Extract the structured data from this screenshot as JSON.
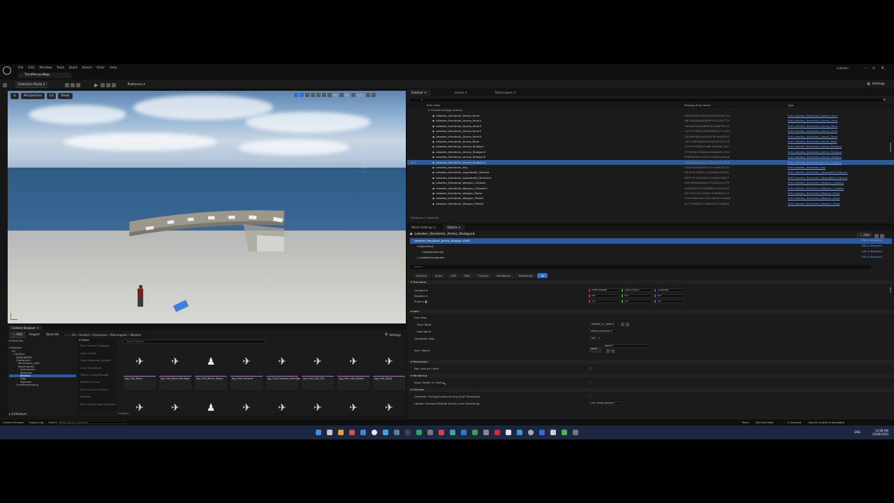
{
  "window": {
    "tab_title": "ThirdPersonMap",
    "user": "Lebedev",
    "settings_label": "Settings"
  },
  "menu": [
    "File",
    "Edit",
    "Window",
    "Tools",
    "Build",
    "Select",
    "Actor",
    "Help"
  ],
  "toolbar": {
    "selection_mode": "Selection Mode",
    "platforms": "Platforms"
  },
  "viewport": {
    "perspective": "Perspective",
    "lit": "Lit",
    "show": "Show",
    "camera_speed": "0.25",
    "fov": "90",
    "grid": "10"
  },
  "content_browser": {
    "tab": "Content Browser",
    "add": "Add",
    "import": "Import",
    "save_all": "Save All",
    "breadcrumb": [
      "All",
      "Content",
      "Characters",
      "Mannequins",
      "Meshes"
    ],
    "settings": "Settings",
    "favorites": "Favorites",
    "project": "lebedev",
    "filters": "Filters",
    "search_placeholder": "Search Meshes",
    "collections": "Collections",
    "item_count": "15 items",
    "tree": [
      "All",
      "Content",
      "GENERATED",
      "Characters",
      "Mannequin_UE4",
      "Mannequins",
      "Animations",
      "Materials",
      "Meshes",
      "Rigs",
      "Textures",
      "LevelPrototyping"
    ],
    "filter_items": [
      "Pose Search Database",
      "Input Action",
      "Input Mapping Context",
      "Level Sequence",
      "Offline Config Budget",
      "Blueprint Class",
      "Pose Search Schema",
      "Material",
      "Pose Search Normalization"
    ],
    "assets": [
      {
        "name": "Jog_Fwd_Back",
        "glyph": "✈"
      },
      {
        "name": "Jog_Fwd_Back_Montage",
        "glyph": "✈"
      },
      {
        "name": "Jog_Fwd_Blend_Space",
        "glyph": "♟"
      },
      {
        "name": "Jog_Fwd_Forward",
        "glyph": "✈"
      },
      {
        "name": "Jog_Fwd_Forward_Montage",
        "glyph": "✈"
      },
      {
        "name": "Jog_Fwd_Left_001",
        "glyph": "✈"
      },
      {
        "name": "Jog_Fwd_Left_Blades",
        "glyph": "✈"
      },
      {
        "name": "Jog_Fwd_Right",
        "glyph": "✈"
      }
    ]
  },
  "status_bar": {
    "content_drawer": "Content Drawer",
    "output_log": "Output Log",
    "cmd": "Cmd",
    "cmd_placeholder": "Enter Console Command",
    "trace": "Trace",
    "derived_data": "Derived Data",
    "unsaved": "2 Unsaved",
    "source_control": "Source Control Unavailable"
  },
  "outliner": {
    "tabs": [
      "Outliner",
      "Levels",
      "Data Layers"
    ],
    "col_label": "Item Label",
    "col_package": "Package Short Name",
    "col_type": "Type",
    "root": "ThirdPersonMap (Editor)",
    "rows": [
      {
        "label": "Lebedev_ItemActor_Ammo_9mm",
        "pkg": "D8F827E0C4DA5D1B7B3A2C44",
        "type": "Edit Lebedev_ItemActor_Ammo_9mm"
      },
      {
        "label": "Lebedev_ItemActor_Ammo_9mm2",
        "pkg": "9B2784D6A4EBF9F0C44A4C7D",
        "type": "Edit Lebedev_ItemActor_Ammo_9mm"
      },
      {
        "label": "Lebedev_ItemActor_Ammo_9mm3",
        "pkg": "C6EA3D5D0A86E4A13B4F9C52",
        "type": "Edit Lebedev_ItemActor_Ammo_9mm"
      },
      {
        "label": "Lebedev_ItemActor_Ammo_9mm4",
        "pkg": "1DF7C7B9E2A3B9DB0CF7C2D3",
        "type": "Edit Lebedev_ItemActor_Ammo_9mm"
      },
      {
        "label": "Lebedev_ItemActor_Ammo_9mm5",
        "pkg": "CA185EAE4A4C6AC9F94A5B10",
        "type": "Edit Lebedev_ItemActor_Ammo_9mm"
      },
      {
        "label": "Lebedev_ItemActor_Ammo_Base",
        "pkg": "7A57DB3960D4904A2BC4F27D",
        "type": "Edit Lebedev_ItemActor_Ammo_Base"
      },
      {
        "label": "Lebedev_ItemActor_Ammo_Shotgun",
        "pkg": "2734F5754E1A3BF3E2B4C1A0",
        "type": "Edit Lebedev_ItemActor_Ammo_Shotgun"
      },
      {
        "label": "Lebedev_ItemActor_Ammo_Shotgun2",
        "pkg": "7FF5E0DC5DD6A2D9BAD1C95C",
        "type": "Edit Lebedev_ItemActor_Ammo_Shotgun"
      },
      {
        "label": "Lebedev_ItemActor_Ammo_Shotgun3",
        "pkg": "F9B7D84E4AA0CA1390E4A61B",
        "type": "Edit Lebedev_ItemActor_Ammo_Shotgun"
      },
      {
        "label": "Lebedev_ItemActor_Ammo_Shotgun4",
        "pkg": "38A5A37E6D8C1FE1D7A23B09",
        "type": "Edit Lebedev_ItemActor_Ammo_Shotgun",
        "selected": true
      },
      {
        "label": "Lebedev_ItemActor_Key",
        "pkg": "C0E5A6AD5E4E37C1A88CD742",
        "type": "Edit Lebedev_ItemActor_Key"
      },
      {
        "label": "Lebedev_ItemActor_UpgradeKit_Silencer",
        "pkg": "EB387E7DB3C1A4F88A2D9E61",
        "type": "Edit Lebedev_ItemActor_UpgradeKit_Silencer"
      },
      {
        "label": "Lebedev_ItemActor_UpgradeKit_Silencer2",
        "pkg": "D95F7F4A2B6E1C1E0D3C8A77",
        "type": "Edit Lebedev_ItemActor_UpgradeKit_Silencer"
      },
      {
        "label": "Lebedev_ItemActor_Weapon_Crowbar",
        "pkg": "95D3B94A84D4F71A3A42A7FE",
        "type": "Edit Lebedev_ItemActor_Weapon_Crowbar"
      },
      {
        "label": "Lebedev_ItemActor_Weapon_Crowbar2",
        "pkg": "0A6D0D75F3A6BB89C5A1E431",
        "type": "Edit Lebedev_ItemActor_Weapon_Crowbar"
      },
      {
        "label": "Lebedev_ItemActor_Weapon_Pistol",
        "pkg": "9D7421C47A4D3C72BF9E3E12",
        "type": "Edit Lebedev_ItemActor_Weapon_Pistol"
      },
      {
        "label": "Lebedev_ItemActor_Weapon_Pistol2",
        "pkg": "CF4E5B00A8C7D41DCB1C9A8D",
        "type": "Edit Lebedev_ItemActor_Weapon_Pistol"
      },
      {
        "label": "Lebedev_ItemActor_Weapon_Pistol3",
        "pkg": "DL17B9B4E0C5BE9E3F41A6D0",
        "type": "Edit Lebedev_ItemActor_Weapon_Pistol"
      }
    ],
    "footer": "138 actors (1 selected)"
  },
  "details": {
    "tabs": [
      "World Settings",
      "Details"
    ],
    "actor_name": "Lebedev_ItemActor_Ammo_Shotgun4",
    "add": "Add",
    "components": [
      {
        "name": "Lebedev_ItemActor_Ammo_Shotgun (Self)",
        "edit": "Edit in Blueprint"
      },
      {
        "name": "StaticMesh",
        "edit": "Edit in Blueprint"
      },
      {
        "name": "LebedevSounds",
        "edit": "Edit in Blueprint"
      },
      {
        "name": "L_UsableComponent",
        "edit": "Edit in Blueprint"
      }
    ],
    "search_placeholder": "Search",
    "filter_tabs": [
      "General",
      "Actor",
      "LOD",
      "Misc",
      "Physics",
      "Rendering",
      "Streaming",
      "All"
    ],
    "sections": {
      "transform": "Transform",
      "item": "Item",
      "replication": "Replication",
      "rendering": "Rendering",
      "collision": "Collision"
    },
    "transform": {
      "location_label": "Location",
      "rotation_label": "Rotation",
      "scale_label": "Scale",
      "location": [
        "1999.000000",
        "1394.215427",
        "-3.000001"
      ],
      "rotation": [
        "0.0°",
        "0.0°",
        "0.0°"
      ],
      "scale": [
        "1.0",
        "1.0",
        "1.0"
      ]
    },
    "item": {
      "item_row_label": "Item Row",
      "data_table_label": "Data Table",
      "data_table_value": "Lebedev_DT_Items",
      "row_name_label": "Row Name",
      "row_name_value": "Ammo_Buckshot",
      "gameplay_tags_label": "Gameplay Tags",
      "gameplay_tags_value": "Edit...",
      "item_object_label": "Item Object",
      "item_object_value": "None",
      "item_object_btn": "None"
    },
    "replication": {
      "net_load_on_client": "Net Load on Client"
    },
    "rendering": {
      "actor_hidden_in_game": "Actor Hidden In Game"
    },
    "collision": {
      "generate_overlap": "Generate Overlap Events During Level Streaming",
      "update_overlaps": "Update Overlaps Method During Level Streaming",
      "update_overlaps_value": "Use Config Default"
    }
  },
  "taskbar": {
    "time": "13:08 AM",
    "date": "23/06/2024",
    "lang": "ENG"
  }
}
